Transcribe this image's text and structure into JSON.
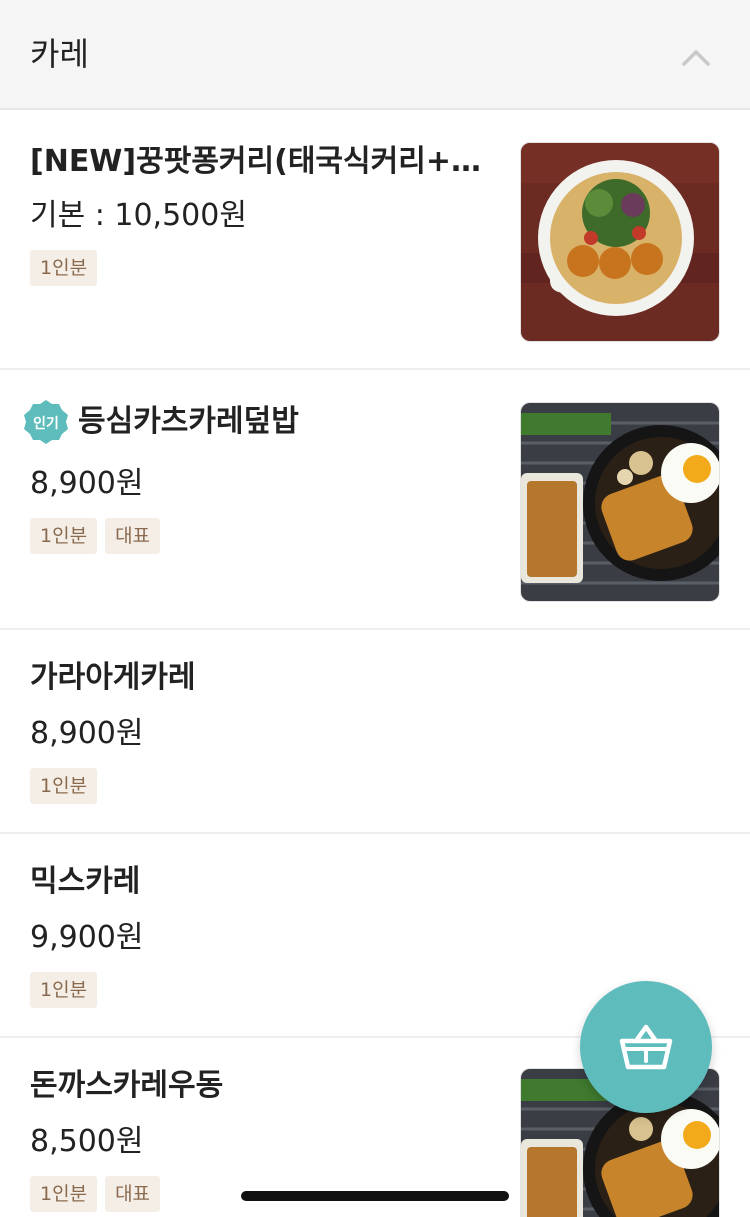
{
  "category": {
    "title": "카레",
    "toggle_icon": "chevron-up-icon"
  },
  "items": [
    {
      "name": "[NEW]꿍팟퐁커리(태국식커리+공…",
      "price": "기본 : 10,500원",
      "tags": [
        "1인분"
      ],
      "popular": false,
      "image": "curry-bowl-photo"
    },
    {
      "name": "등심카츠카레덮밥",
      "price": "8,900원",
      "tags": [
        "1인분",
        "대표"
      ],
      "popular": true,
      "popular_badge_text": "인기",
      "image": "katsu-curry-photo"
    },
    {
      "name": "가라아게카레",
      "price": "8,900원",
      "tags": [
        "1인분"
      ],
      "popular": false
    },
    {
      "name": "믹스카레",
      "price": "9,900원",
      "tags": [
        "1인분"
      ],
      "popular": false
    },
    {
      "name": "돈까스카레우동",
      "price": "8,500원",
      "tags": [
        "1인분",
        "대표"
      ],
      "popular": false,
      "image": "katsu-curry-photo"
    }
  ],
  "cart": {
    "icon": "basket-icon",
    "color": "#5ebcbc"
  },
  "colors": {
    "tag_bg": "#f5eee7",
    "tag_text": "#8a6a4f",
    "badge": "#5ebcbc"
  }
}
